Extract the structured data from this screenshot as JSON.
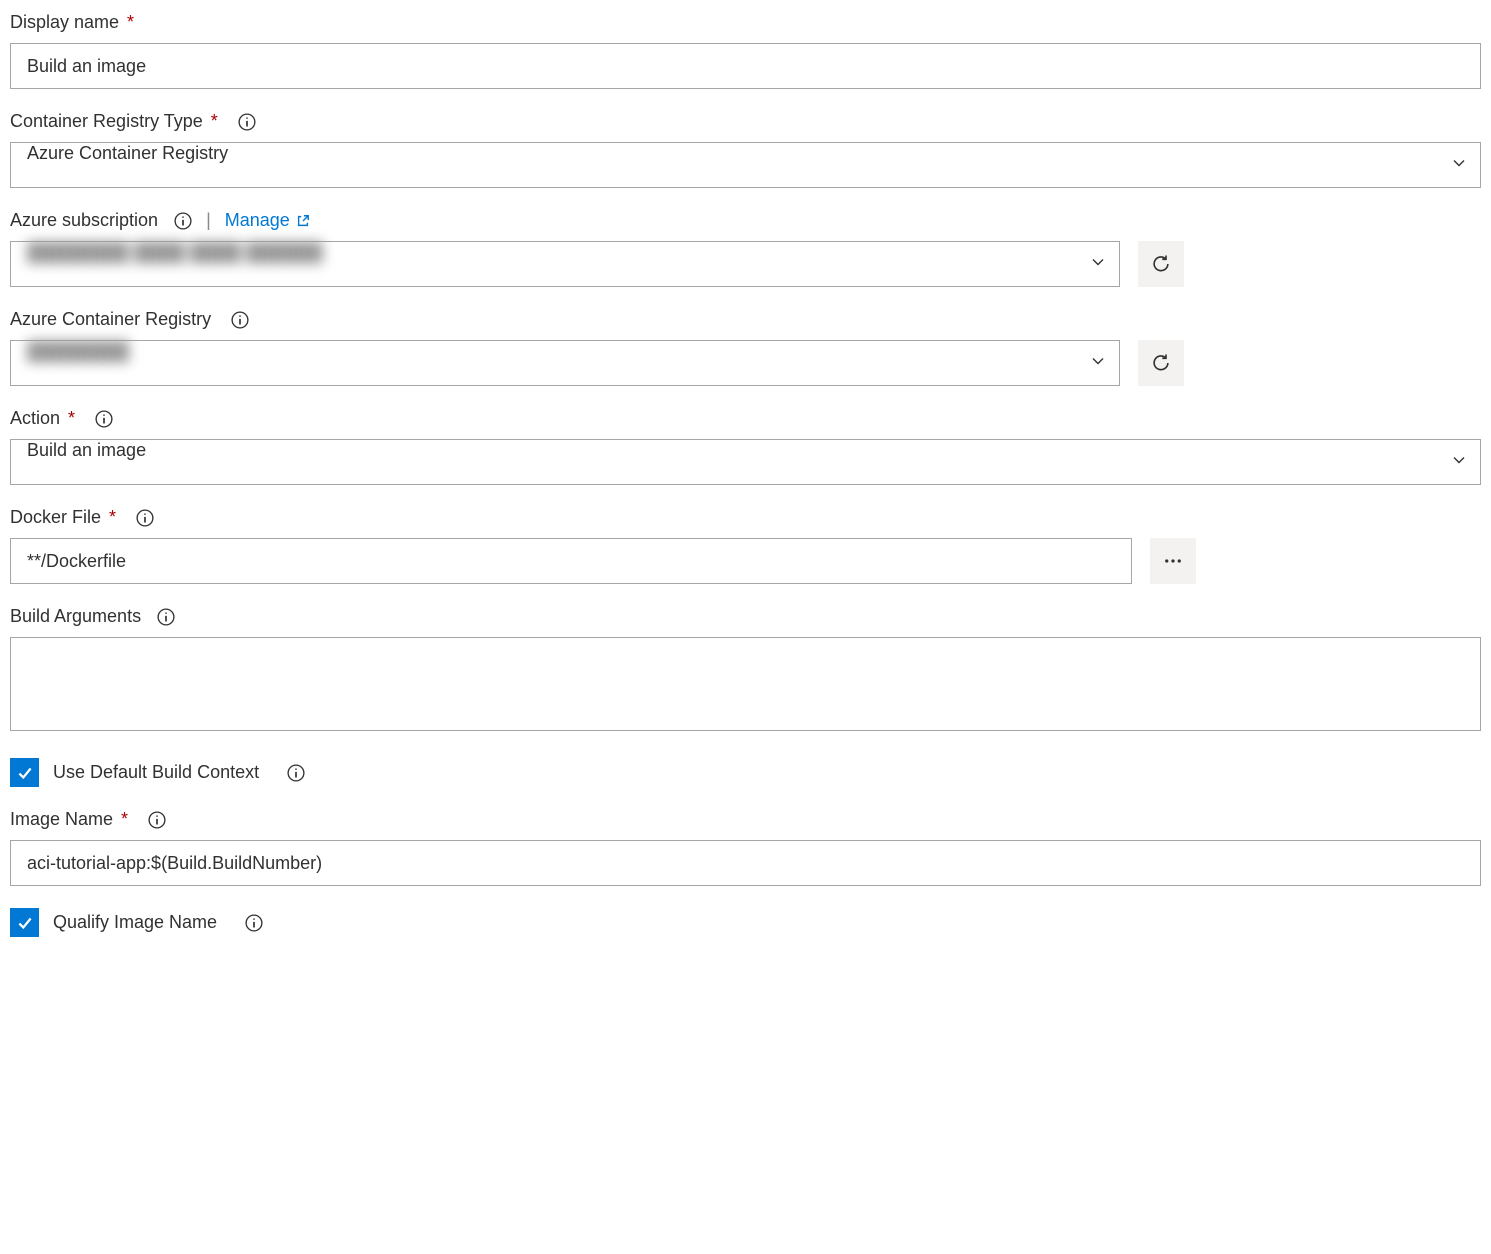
{
  "fields": {
    "display_name": {
      "label": "Display name",
      "value": "Build an image"
    },
    "container_registry_type": {
      "label": "Container Registry Type",
      "value": "Azure Container Registry"
    },
    "azure_subscription": {
      "label": "Azure subscription",
      "manage_label": "Manage",
      "value": "████████ ████ ████ ██████"
    },
    "azure_container_registry": {
      "label": "Azure Container Registry",
      "value": "████████"
    },
    "action": {
      "label": "Action",
      "value": "Build an image"
    },
    "docker_file": {
      "label": "Docker File",
      "value": "**/Dockerfile"
    },
    "build_arguments": {
      "label": "Build Arguments",
      "value": ""
    },
    "use_default_build_context": {
      "label": "Use Default Build Context"
    },
    "image_name": {
      "label": "Image Name",
      "value": "aci-tutorial-app:$(Build.BuildNumber)"
    },
    "qualify_image_name": {
      "label": "Qualify Image Name"
    }
  }
}
